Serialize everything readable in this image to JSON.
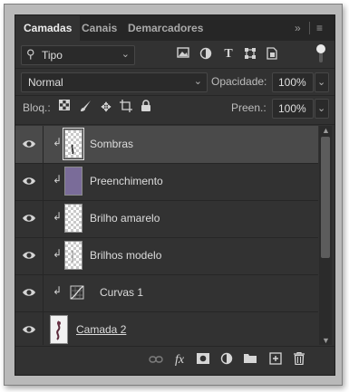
{
  "tabs": [
    {
      "label": "Camadas",
      "active": true
    },
    {
      "label": "Canais",
      "active": false
    },
    {
      "label": "Demarcadores",
      "active": false
    }
  ],
  "tabbar_icons": {
    "collapse": "»",
    "menu": "≡"
  },
  "filter": {
    "kind_label": "Tipo",
    "icons": [
      "image-filter-icon",
      "adjustment-filter-icon",
      "type-filter-icon",
      "shape-filter-icon",
      "smart-object-filter-icon"
    ],
    "filter_enabled": true
  },
  "blend": {
    "mode": "Normal",
    "opacity_label": "Opacidade:",
    "opacity": "100%"
  },
  "lock": {
    "label": "Bloq.:",
    "fill_label": "Preen.:",
    "fill": "100%"
  },
  "layers": [
    {
      "name": "Sombras",
      "visible": true,
      "clipped": true,
      "thumb": "checker",
      "selected": true
    },
    {
      "name": "Preenchimento",
      "visible": true,
      "clipped": true,
      "thumb": "fill",
      "fill_color": "#7a6c99",
      "selected": false
    },
    {
      "name": "Brilho amarelo",
      "visible": true,
      "clipped": true,
      "thumb": "checker",
      "selected": false
    },
    {
      "name": "Brilhos modelo",
      "visible": true,
      "clipped": true,
      "thumb": "checker",
      "selected": false
    },
    {
      "name": "Curvas 1",
      "visible": true,
      "clipped": true,
      "thumb": "curves",
      "selected": false
    },
    {
      "name": "Camada 2",
      "visible": true,
      "clipped": false,
      "thumb": "photo",
      "selected": false
    }
  ],
  "bottom_icons": [
    "link-layers-icon",
    "fx-icon",
    "mask-icon",
    "adjustment-layer-icon",
    "group-folder-icon",
    "new-layer-icon",
    "trash-icon"
  ],
  "bottom_fx_label": "fx",
  "colors": {
    "panel": "#323232",
    "tabbar": "#262626",
    "selected_row": "#4a4a4a",
    "fill_swatch": "#7a6c99"
  }
}
